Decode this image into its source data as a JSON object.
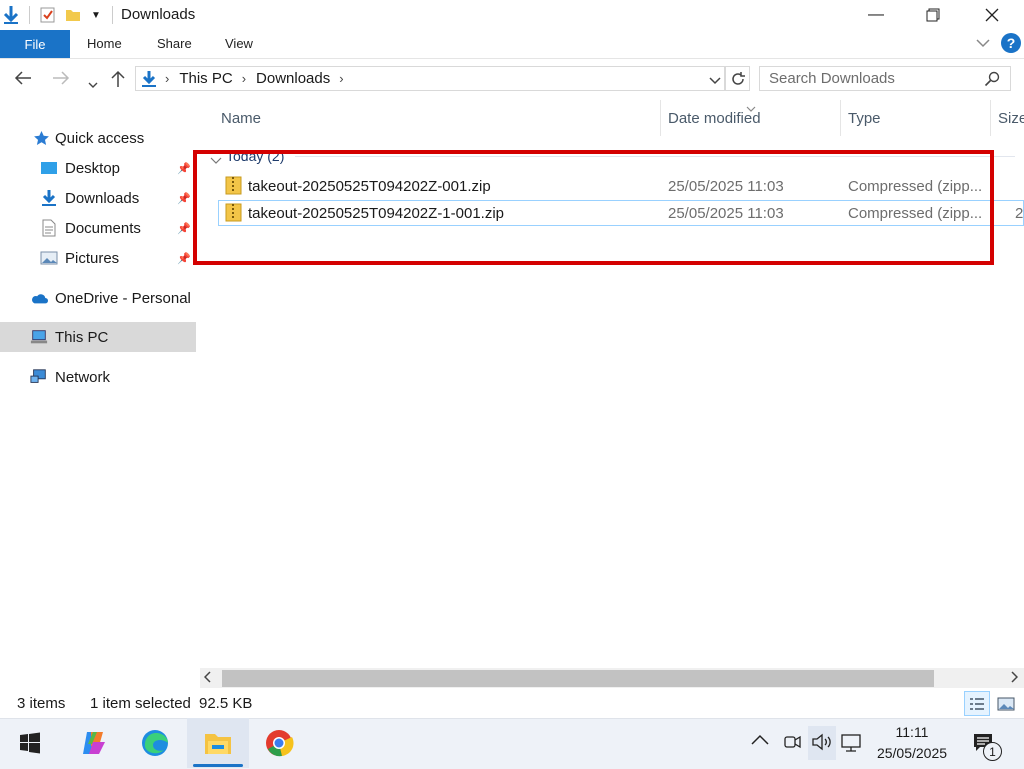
{
  "window": {
    "title": "Downloads",
    "controls": {
      "minimize": "—",
      "maximize": "❐",
      "close": "✕"
    }
  },
  "ribbon": {
    "tabs": [
      "File",
      "Home",
      "Share",
      "View"
    ]
  },
  "address": {
    "breadcrumb": [
      "This PC",
      "Downloads"
    ],
    "search_placeholder": "Search Downloads"
  },
  "nav": {
    "quick_access": "Quick access",
    "items": [
      "Desktop",
      "Downloads",
      "Documents",
      "Pictures"
    ],
    "onedrive": "OneDrive - Personal",
    "thispc": "This PC",
    "network": "Network"
  },
  "columns": [
    "Name",
    "Date modified",
    "Type",
    "Size"
  ],
  "group": {
    "label": "Today (2)"
  },
  "files": [
    {
      "name": "takeout-20250525T094202Z-001.zip",
      "date": "25/05/2025 11:03",
      "type": "Compressed (zipp...",
      "size": "",
      "selected": false
    },
    {
      "name": "takeout-20250525T094202Z-1-001.zip",
      "date": "25/05/2025 11:03",
      "type": "Compressed (zipp...",
      "size": "2",
      "selected": true
    }
  ],
  "status": {
    "count": "3 items",
    "selection": "1 item selected",
    "size": "92.5 KB"
  },
  "taskbar": {
    "time": "11:11",
    "date": "25/05/2025",
    "notification_count": "1"
  },
  "colors": {
    "accent": "#1a73c7",
    "highlight": "#d40000"
  }
}
